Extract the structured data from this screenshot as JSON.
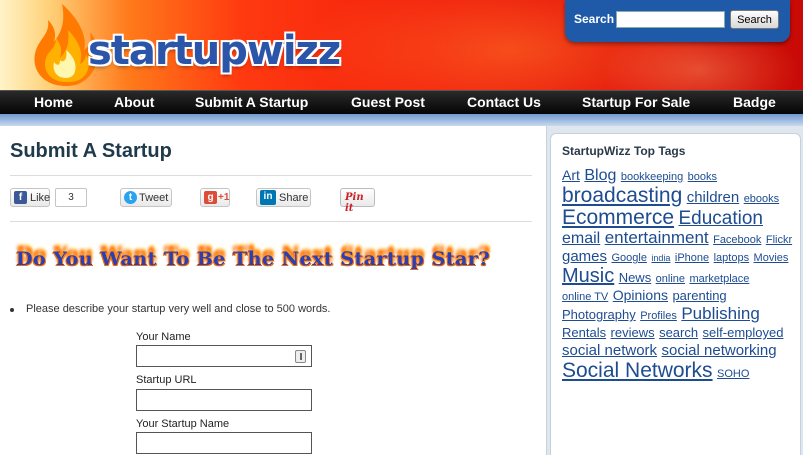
{
  "header": {
    "logo_text": "startupwizz",
    "search_label": "Search",
    "search_value": "",
    "search_button": "Search"
  },
  "nav": [
    "Home",
    "About",
    "Submit A Startup",
    "Guest Post",
    "Contact Us",
    "Startup For Sale",
    "Badge"
  ],
  "main": {
    "title": "Submit A Startup",
    "social": {
      "like_label": "Like",
      "like_count": "3",
      "tweet_label": "Tweet",
      "gplus_label": "+1",
      "share_label": "Share",
      "pinit_label": "Pin it"
    },
    "banner_text": "Do You Want To Be The Next Startup Star?",
    "instruction": "Please describe your startup very well and close to 500 words.",
    "form": {
      "name_label": "Your Name",
      "name_value": "",
      "url_label": "Startup URL",
      "url_value": "",
      "startup_name_label": "Your Startup Name",
      "startup_name_value": ""
    }
  },
  "sidebar": {
    "title": "StartupWizz Top Tags",
    "tags": [
      {
        "text": "Art",
        "size": 14
      },
      {
        "text": "Blog",
        "size": 16
      },
      {
        "text": "bookkeeping",
        "size": 11
      },
      {
        "text": "books",
        "size": 11
      },
      {
        "text": "broadcasting",
        "size": 21
      },
      {
        "text": "children",
        "size": 15
      },
      {
        "text": "ebooks",
        "size": 11
      },
      {
        "text": "Ecommerce",
        "size": 21
      },
      {
        "text": "Education",
        "size": 19
      },
      {
        "text": "email",
        "size": 16
      },
      {
        "text": "entertainment",
        "size": 17
      },
      {
        "text": "Facebook",
        "size": 11
      },
      {
        "text": "Flickr",
        "size": 11
      },
      {
        "text": "games",
        "size": 15
      },
      {
        "text": "Google",
        "size": 11
      },
      {
        "text": "india",
        "size": 9
      },
      {
        "text": "iPhone",
        "size": 11
      },
      {
        "text": "laptops",
        "size": 11
      },
      {
        "text": "Movies",
        "size": 11
      },
      {
        "text": "Music",
        "size": 20
      },
      {
        "text": "News",
        "size": 13
      },
      {
        "text": "online",
        "size": 11
      },
      {
        "text": "marketplace",
        "size": 11
      },
      {
        "text": "online TV",
        "size": 11
      },
      {
        "text": "Opinions",
        "size": 14
      },
      {
        "text": "parenting",
        "size": 13
      },
      {
        "text": "Photography",
        "size": 13
      },
      {
        "text": "Profiles",
        "size": 11
      },
      {
        "text": "Publishing",
        "size": 17
      },
      {
        "text": "Rentals",
        "size": 13
      },
      {
        "text": "reviews",
        "size": 13
      },
      {
        "text": "search",
        "size": 13
      },
      {
        "text": "self-employed",
        "size": 13
      },
      {
        "text": "social network",
        "size": 15
      },
      {
        "text": "social networking",
        "size": 15
      },
      {
        "text": "Social Networks",
        "size": 21
      },
      {
        "text": "SOHO",
        "size": 11
      }
    ]
  },
  "colors": {
    "nav_bg": "#000000",
    "link": "#1e4c91",
    "search_panel": "#1e5aa8",
    "title": "#1f3a4a"
  }
}
